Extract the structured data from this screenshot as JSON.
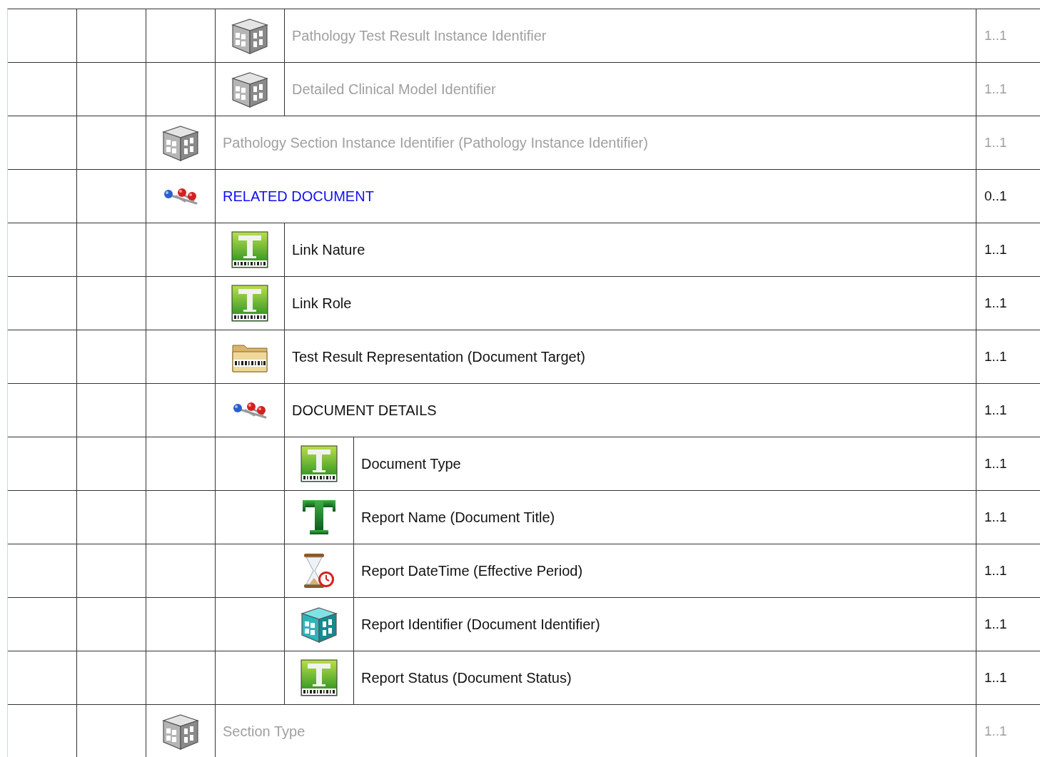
{
  "rows": [
    {
      "children": [
        {
          "kind": "identifier",
          "label": "Pathology Test Result Instance Identifier",
          "occurrence": "1..1",
          "disabled": true,
          "link": false
        },
        {
          "kind": "identifier",
          "label": "Detailed Clinical Model Identifier",
          "occurrence": "1..1",
          "disabled": true,
          "link": false
        }
      ]
    },
    {
      "kind": "identifier",
      "label": "Pathology Section Instance Identifier (Pathology Instance Identifier)",
      "occurrence": "1..1",
      "disabled": true,
      "link": false
    },
    {
      "kind": "cluster",
      "label": "RELATED DOCUMENT",
      "occurrence": "0..1",
      "disabled": false,
      "link": true,
      "children": [
        {
          "kind": "coded",
          "label": "Link Nature",
          "occurrence": "1..1",
          "disabled": false,
          "link": false
        },
        {
          "kind": "coded",
          "label": "Link Role",
          "occurrence": "1..1",
          "disabled": false,
          "link": false
        },
        {
          "kind": "multimedia",
          "label": "Test Result Representation (Document Target)",
          "occurrence": "1..1",
          "disabled": false,
          "link": false
        },
        {
          "kind": "cluster",
          "label": "DOCUMENT DETAILS",
          "occurrence": "1..1",
          "disabled": false,
          "link": false,
          "children": [
            {
              "kind": "coded",
              "label": "Document Type",
              "occurrence": "1..1",
              "disabled": false,
              "link": false
            },
            {
              "kind": "text",
              "label": "Report Name (Document Title)",
              "occurrence": "1..1",
              "disabled": false,
              "link": false
            },
            {
              "kind": "datetime",
              "label": "Report DateTime (Effective Period)",
              "occurrence": "1..1",
              "disabled": false,
              "link": false
            },
            {
              "kind": "identifier",
              "label": "Report Identifier (Document Identifier)",
              "occurrence": "1..1",
              "disabled": false,
              "link": false
            },
            {
              "kind": "coded",
              "label": "Report Status (Document Status)",
              "occurrence": "1..1",
              "disabled": false,
              "link": false
            }
          ]
        }
      ]
    },
    {
      "kind": "identifier",
      "label": "Section Type",
      "occurrence": "1..1",
      "disabled": true,
      "link": false
    }
  ]
}
